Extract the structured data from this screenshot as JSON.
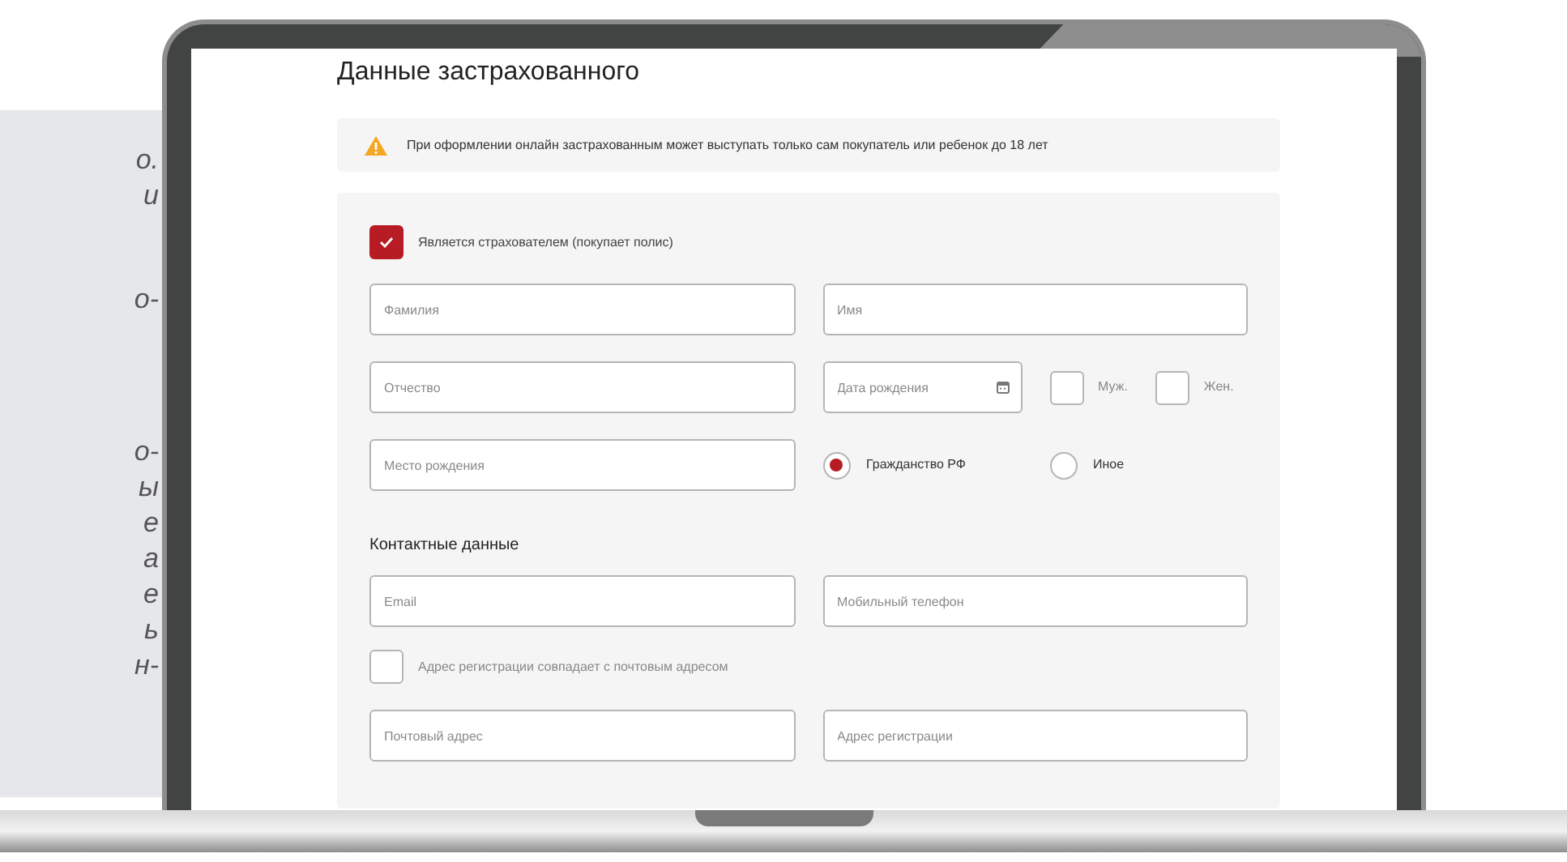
{
  "side_text": [
    [
      "о.",
      "и"
    ],
    [
      "о-"
    ],
    [
      "о-",
      "ы",
      "е",
      "а",
      "е",
      "ь",
      "н-"
    ]
  ],
  "form": {
    "title": "Данные застрахованного",
    "notice": "При оформлении онлайн застрахованным может выступать только сам покупатель или ребенок до 18 лет",
    "policyholder": {
      "label": "Является страхователем (покупает полис)",
      "checked": true
    },
    "fields_1": [
      {
        "placeholder": "Фамилия"
      },
      {
        "placeholder": "Имя"
      },
      {
        "placeholder": "Отчество"
      }
    ],
    "birth_date": {
      "placeholder": "Дата рождения"
    },
    "gender": [
      {
        "label": "Муж.",
        "checked": false
      },
      {
        "label": "Жен.",
        "checked": false
      }
    ],
    "birth_place": {
      "placeholder": "Место рождения"
    },
    "citizenship": [
      {
        "label": "Гражданство РФ",
        "selected": true
      },
      {
        "label": "Иное",
        "selected": false
      }
    ],
    "contacts_title": "Контактные данные",
    "contacts": [
      {
        "placeholder": "Email"
      },
      {
        "placeholder": "Мобильный телефон"
      }
    ],
    "same_address": {
      "label": "Адрес регистрации совпадает с почтовым адресом",
      "checked": false
    },
    "addresses": [
      {
        "placeholder": "Почтовый адрес"
      },
      {
        "placeholder": "Адрес регистрации"
      }
    ]
  }
}
